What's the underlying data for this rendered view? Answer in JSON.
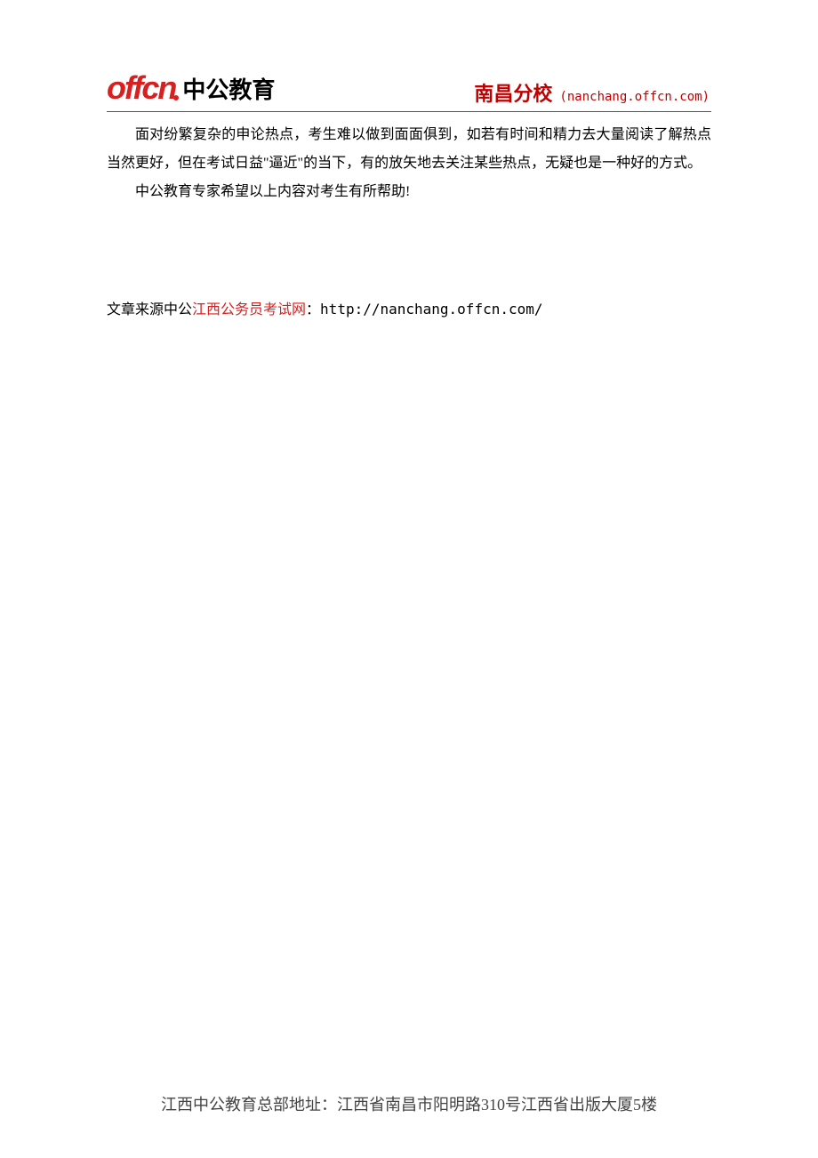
{
  "header": {
    "logo_en": "offcn",
    "logo_cn": "中公教育",
    "branch_name": "南昌分校",
    "branch_url": "(nanchang.offcn.com)"
  },
  "body": {
    "para1": "面对纷繁复杂的申论热点，考生难以做到面面俱到，如若有时间和精力去大量阅读了解热点当然更好，但在考试日益\"逼近\"的当下，有的放矢地去关注某些热点，无疑也是一种好的方式。",
    "para2": "中公教育专家希望以上内容对考生有所帮助!"
  },
  "source": {
    "prefix": "文章来源中公",
    "link_text": "江西公务员考试网",
    "colon": "：",
    "url": "http://nanchang.offcn.com/"
  },
  "footer": {
    "address": "江西中公教育总部地址：江西省南昌市阳明路310号江西省出版大厦5楼"
  }
}
